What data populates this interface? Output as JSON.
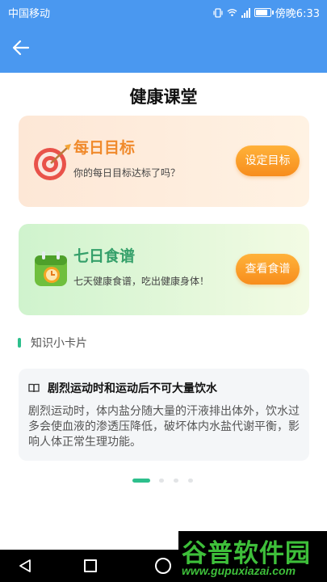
{
  "status": {
    "carrier": "中国移动",
    "time": "傍晚6:33",
    "battery_level": 0.75,
    "icons": [
      "vibrate-icon",
      "wifi-icon",
      "signal-icon",
      "battery-icon"
    ]
  },
  "appbar": {
    "back_icon": "arrow-left-icon"
  },
  "page": {
    "title": "健康课堂"
  },
  "goal_card": {
    "title": "每日目标",
    "subtitle": "你的每日目标达标了吗？",
    "button": "设定目标",
    "icon": "target-dart-icon"
  },
  "recipe_card": {
    "title": "七日食谱",
    "subtitle": "七天健康食谱，吃出健康身体！",
    "button": "查看食谱",
    "icon": "calendar-clock-icon"
  },
  "knowledge": {
    "section_label": "知识小卡片",
    "card_title": "剧烈运动时和运动后不可大量饮水",
    "card_body": "剧烈运动时，体内盐分随大量的汗液排出体外，饮水过多会使血液的渗透压降低，破坏体内水盐代谢平衡，影响人体正常生理功能。",
    "page_count": 4,
    "active_page": 1
  },
  "navbar": {
    "icons": [
      "nav-back-icon",
      "nav-home-icon",
      "nav-recent-icon"
    ]
  },
  "watermark": {
    "title": "谷普软件园",
    "url": "www.gupuxiazai.com"
  },
  "colors": {
    "primary": "#4a98f0",
    "accent_orange": "#f78d1c",
    "accent_green": "#2dbf8c"
  }
}
